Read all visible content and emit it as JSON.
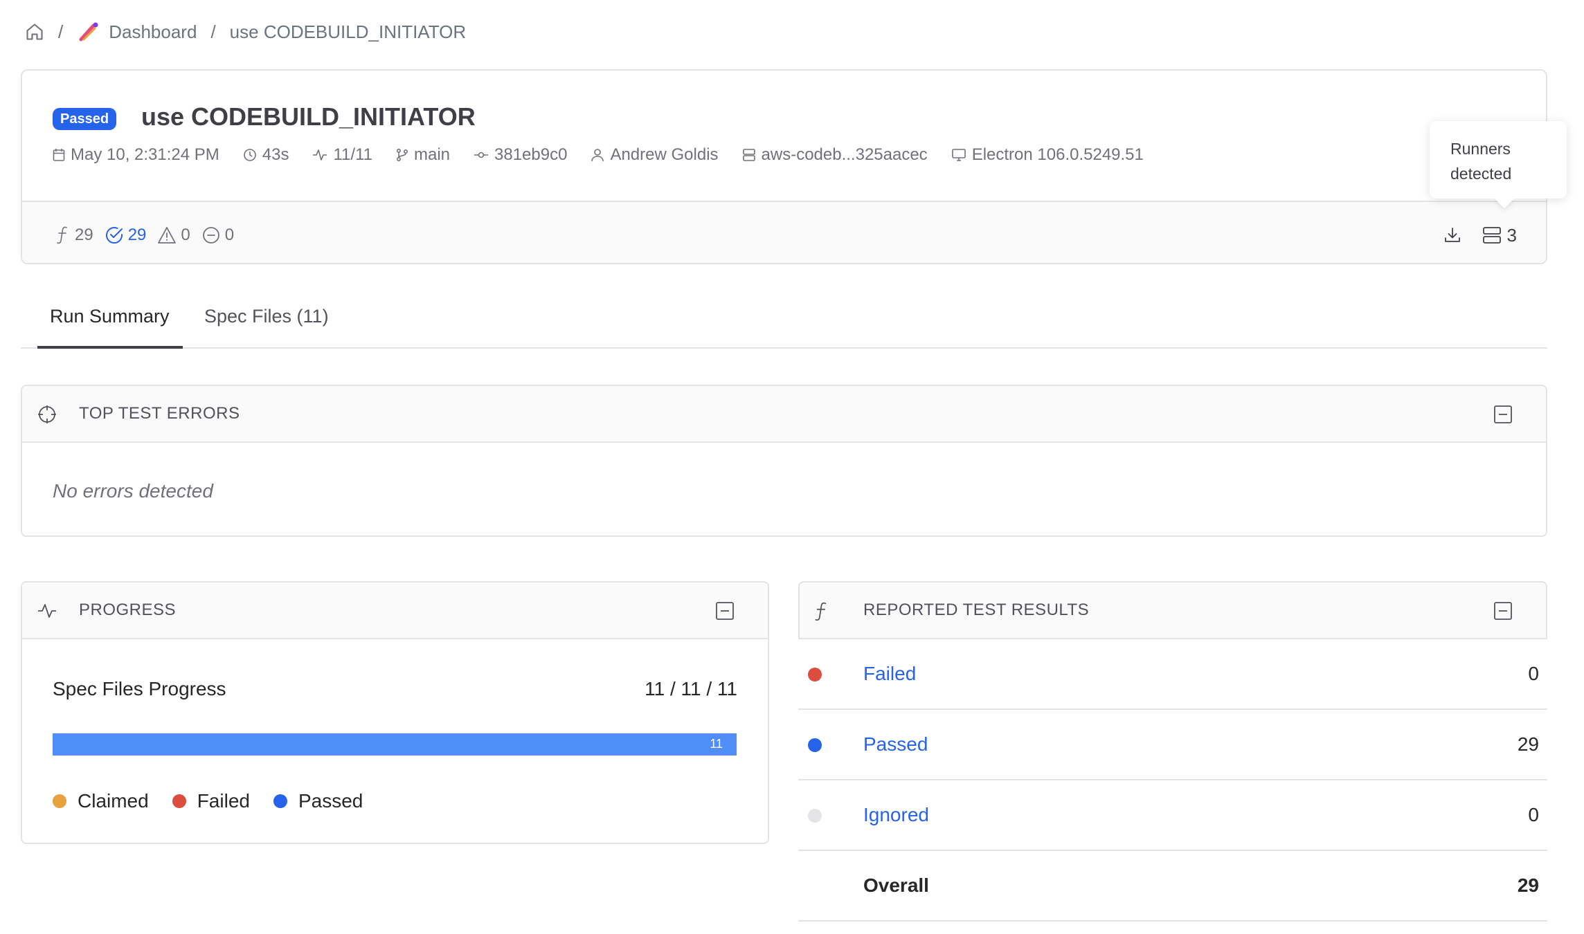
{
  "breadcrumb": {
    "dashboard": "Dashboard",
    "current": "use CODEBUILD_INITIATOR",
    "separator": "/"
  },
  "run": {
    "status": "Passed",
    "title": "use CODEBUILD_INITIATOR",
    "date": "May 10, 2:31:24 PM",
    "duration": "43s",
    "progress": "11/11",
    "branch": "main",
    "commit": "381eb9c0",
    "author": "Andrew Goldis",
    "ci_build": "aws-codeb...325aacec",
    "browser": "Electron 106.0.5249.51"
  },
  "stats": {
    "total": "29",
    "passed": "29",
    "flaky": "0",
    "skipped": "0",
    "runners": "3"
  },
  "tooltip": {
    "text": "Runners detected"
  },
  "tabs": {
    "summary": "Run Summary",
    "spec_files": "Spec Files (11)"
  },
  "errors": {
    "title": "TOP TEST ERRORS",
    "empty": "No errors detected"
  },
  "progress": {
    "title": "PROGRESS",
    "label": "Spec Files Progress",
    "count": "11 / 11 / 11",
    "passed_fraction": 1.0,
    "bar_label": "11",
    "legend": [
      {
        "label": "Claimed",
        "color": "#e9a23b"
      },
      {
        "label": "Failed",
        "color": "#dc4c3f"
      },
      {
        "label": "Passed",
        "color": "#2563eb"
      }
    ]
  },
  "results": {
    "title": "REPORTED TEST RESULTS",
    "rows": [
      {
        "label": "Failed",
        "value": "0",
        "color": "#dc4c3f"
      },
      {
        "label": "Passed",
        "value": "29",
        "color": "#2563eb"
      },
      {
        "label": "Ignored",
        "value": "0",
        "color": "#e4e4e7"
      }
    ],
    "overall_label": "Overall",
    "overall_value": "29"
  },
  "colors": {
    "accent": "#2563eb",
    "progress_fill": "#4f8ef7"
  }
}
